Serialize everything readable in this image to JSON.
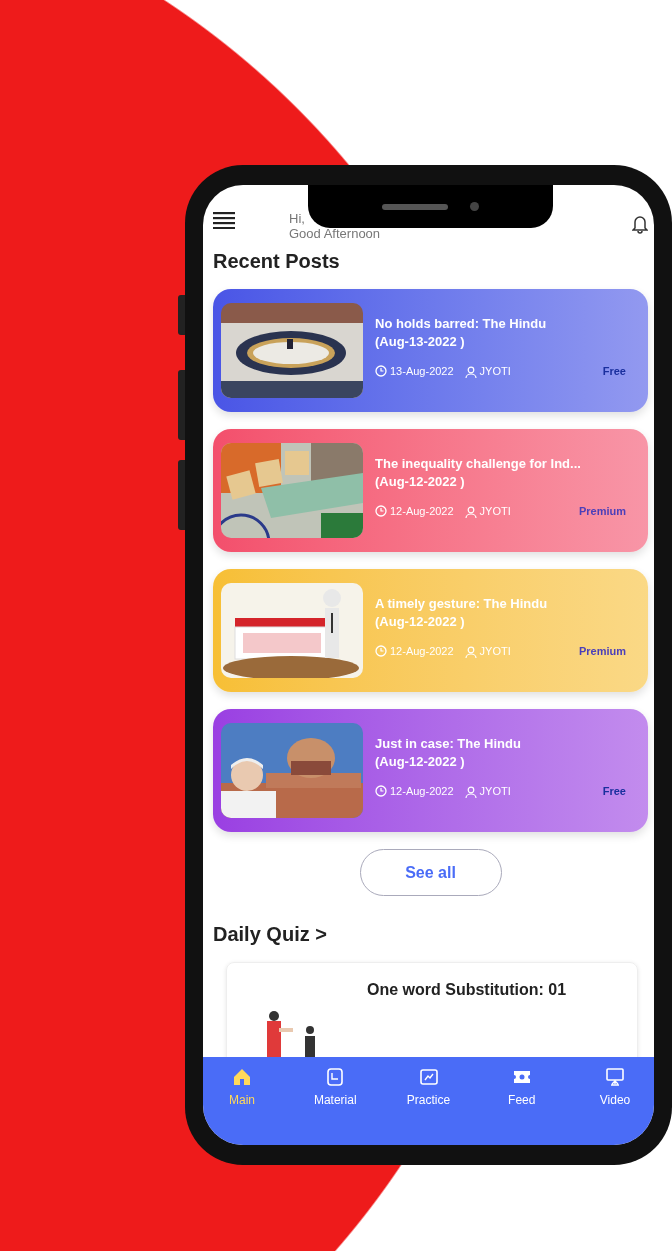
{
  "header": {
    "greeting": "Hi,",
    "subtitle": "Good Afternoon"
  },
  "recent_posts": {
    "title": "Recent Posts",
    "posts": [
      {
        "title": "No holds barred: The Hindu",
        "date_label": "(Aug-13-2022 )",
        "date": "13-Aug-2022",
        "author": "JYOTI",
        "access": "Free",
        "premium": false,
        "color": "#4a55e6"
      },
      {
        "title": "The inequality challenge for Ind...",
        "date_label": "(Aug-12-2022 )",
        "date": "12-Aug-2022",
        "author": "JYOTI",
        "access": "Premium",
        "premium": true,
        "color": "#f34f6c"
      },
      {
        "title": "A timely gesture: The Hindu",
        "date_label": "(Aug-12-2022 )",
        "date": "12-Aug-2022",
        "author": "JYOTI",
        "access": "Premium",
        "premium": true,
        "color": "#f7bf35"
      },
      {
        "title": "Just in case: The Hindu",
        "date_label": "(Aug-12-2022 )",
        "date": "12-Aug-2022",
        "author": "JYOTI",
        "access": "Free",
        "premium": false,
        "color": "#9a3fe2"
      }
    ],
    "see_all": "See all"
  },
  "daily_quiz": {
    "title": "Daily Quiz >",
    "quiz": {
      "title": "One word Substitution: 01"
    }
  },
  "bottom_nav": [
    {
      "label": "Main",
      "selected": true
    },
    {
      "label": "Material",
      "selected": false
    },
    {
      "label": "Practice",
      "selected": false
    },
    {
      "label": "Feed",
      "selected": false
    },
    {
      "label": "Video",
      "selected": false
    }
  ]
}
